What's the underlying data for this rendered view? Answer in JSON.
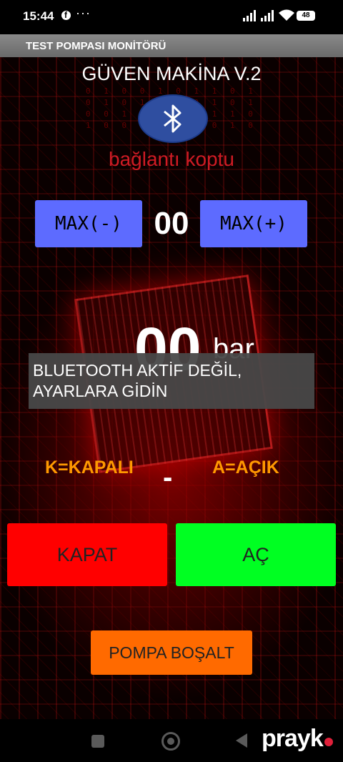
{
  "status_bar": {
    "time": "15:44",
    "more": "···",
    "battery": "48"
  },
  "app_bar": {
    "title": "TEST POMPASI MONİTÖRÜ"
  },
  "header": {
    "device_title": "GÜVEN MAKİNA V.2",
    "connection_status": "bağlantı koptu"
  },
  "max_control": {
    "minus_label": "MAX(-)",
    "value": "00",
    "plus_label": "MAX(+)"
  },
  "pressure": {
    "value": "00",
    "unit": "bar"
  },
  "toast": {
    "line1": "BLUETOOTH AKTİF DEĞİL,",
    "line2": "AYARLARA GİDİN"
  },
  "legend": {
    "closed": "K=KAPALI",
    "state": "-",
    "open": "A=AÇIK"
  },
  "buttons": {
    "close": "KAPAT",
    "open": "AÇ",
    "drain": "POMPA BOŞALT"
  },
  "watermark": "prayk",
  "background_binary": "0 1 0 0 1 0 1 1 0 1 0 1 0 1 1 0 0 1 0 1 0 0 1 1 0 1 0 1 1 0 1 0 0 1 0 1 1 0 1 0",
  "colors": {
    "max_button": "#5d6bff",
    "close_button": "#ff0000",
    "open_button": "#00ff22",
    "drain_button": "#ff6a00",
    "connection_status": "#cf1b24",
    "legend": "#ff9900",
    "bluetooth_button": "#2f4ea0"
  },
  "icons": [
    "facebook-icon",
    "signal-icon",
    "wifi-icon",
    "battery-icon",
    "bluetooth-icon",
    "nav-recent-icon",
    "nav-home-icon",
    "nav-back-icon"
  ]
}
